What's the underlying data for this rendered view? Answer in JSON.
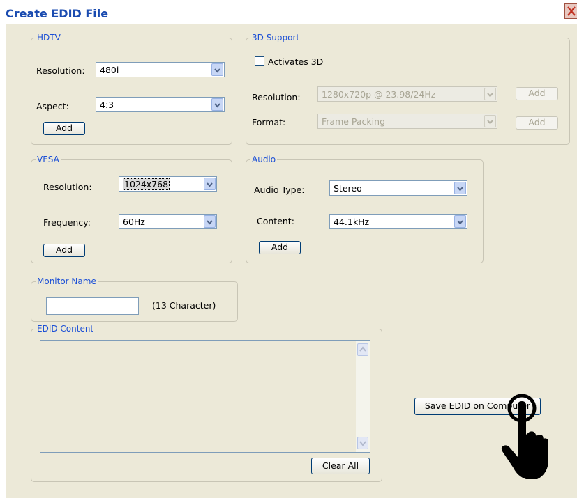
{
  "window": {
    "title": "Create EDID File"
  },
  "hdtv": {
    "legend": "HDTV",
    "resolution_label": "Resolution:",
    "resolution_value": "480i",
    "aspect_label": "Aspect:",
    "aspect_value": "4:3",
    "add_label": "Add"
  },
  "support3d": {
    "legend": "3D Support",
    "activates_label": "Activates 3D",
    "activates_checked": false,
    "resolution_label": "Resolution:",
    "resolution_value": "1280x720p @ 23.98/24Hz",
    "format_label": "Format:",
    "format_value": "Frame Packing",
    "add_label": "Add",
    "enabled": false
  },
  "vesa": {
    "legend": "VESA",
    "resolution_label": "Resolution:",
    "resolution_value": "1024x768",
    "frequency_label": "Frequency:",
    "frequency_value": "60Hz",
    "add_label": "Add"
  },
  "audio": {
    "legend": "Audio",
    "type_label": "Audio Type:",
    "type_value": "Stereo",
    "content_label": "Content:",
    "content_value": "44.1kHz",
    "add_label": "Add"
  },
  "monitor": {
    "legend": "Monitor Name",
    "value": "",
    "hint": "(13 Character)"
  },
  "edid": {
    "legend": "EDID Content",
    "content": "",
    "clear_label": "Clear All"
  },
  "save_label": "Save EDID on Computer",
  "colors": {
    "legend": "#1b4fd6",
    "title": "#1a4bb0",
    "dialog_bg": "#ece9d8"
  },
  "icons": {
    "close": "close-icon",
    "dropdown": "chevron-down-icon",
    "pointer": "hand-pointer-icon"
  }
}
